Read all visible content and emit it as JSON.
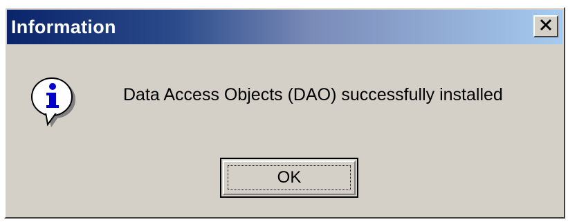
{
  "window": {
    "title": "Information",
    "close_icon": "close-icon",
    "title_gradient": [
      "#0a246a",
      "#a6caf0"
    ]
  },
  "body": {
    "icon": "information-icon",
    "message": "Data Access Objects (DAO) successfully installed"
  },
  "buttons": {
    "ok_label": "OK"
  }
}
